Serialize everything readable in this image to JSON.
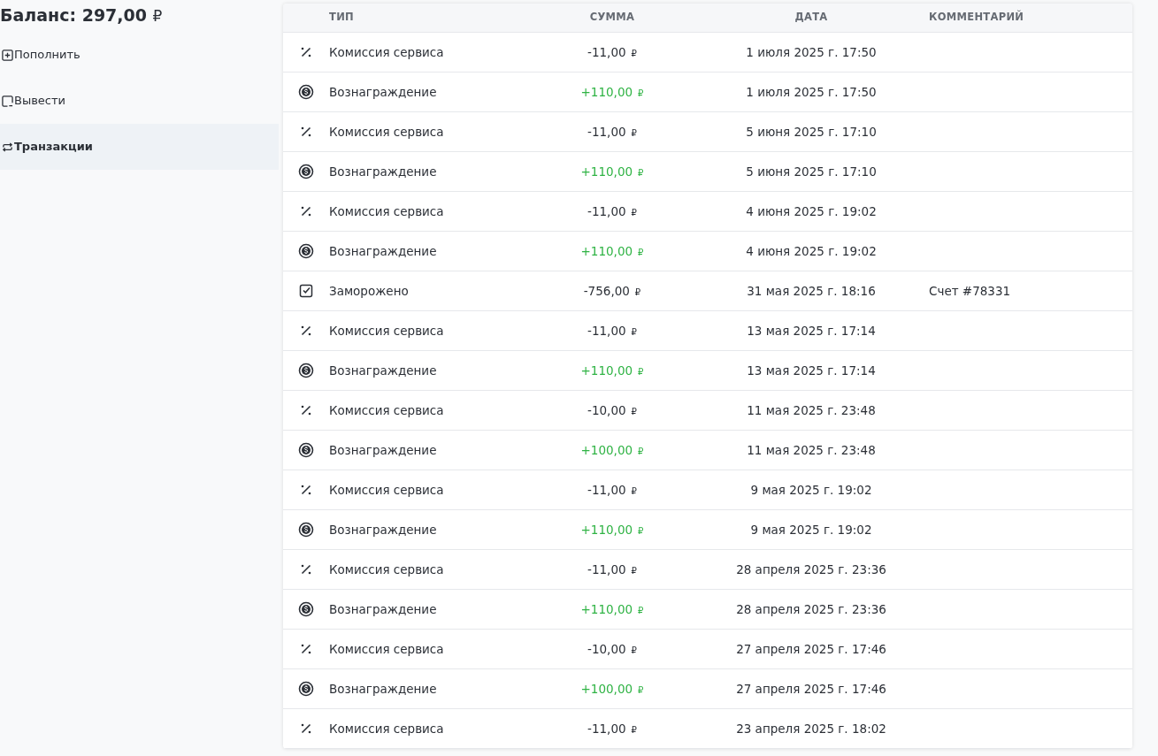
{
  "balance": {
    "label": "Баланс:",
    "amount": "297,00",
    "currency": "₽"
  },
  "menu": [
    {
      "label": "Пополнить",
      "kind": "deposit",
      "selected": false
    },
    {
      "label": "Вывести",
      "kind": "withdraw",
      "selected": false
    },
    {
      "label": "Транзакции",
      "kind": "transactions",
      "selected": true
    }
  ],
  "table": {
    "columns": [
      "ТИП",
      "СУММА",
      "ДАТА",
      "КОММЕНТАРИЙ"
    ],
    "rows": [
      {
        "kind": "commission",
        "type": "Комиссия сервиса",
        "amount": "-11,00",
        "currency": "₽",
        "positive": false,
        "date": "1 июля 2025 г. 17:50"
      },
      {
        "kind": "reward",
        "type": "Вознаграждение",
        "amount": "+110,00",
        "currency": "₽",
        "positive": true,
        "date": "1 июля 2025 г. 17:50"
      },
      {
        "kind": "commission",
        "type": "Комиссия сервиса",
        "amount": "-11,00",
        "currency": "₽",
        "positive": false,
        "date": "5 июня 2025 г. 17:10"
      },
      {
        "kind": "reward",
        "type": "Вознаграждение",
        "amount": "+110,00",
        "currency": "₽",
        "positive": true,
        "date": "5 июня 2025 г. 17:10"
      },
      {
        "kind": "commission",
        "type": "Комиссия сервиса",
        "amount": "-11,00",
        "currency": "₽",
        "positive": false,
        "date": "4 июня 2025 г. 19:02"
      },
      {
        "kind": "reward",
        "type": "Вознаграждение",
        "amount": "+110,00",
        "currency": "₽",
        "positive": true,
        "date": "4 июня 2025 г. 19:02"
      },
      {
        "kind": "frozen",
        "type": "Заморожено",
        "amount": "-756,00",
        "currency": "₽",
        "positive": false,
        "date": "31 мая 2025 г. 18:16",
        "comment": "Счет #78331"
      },
      {
        "kind": "commission",
        "type": "Комиссия сервиса",
        "amount": "-11,00",
        "currency": "₽",
        "positive": false,
        "date": "13 мая 2025 г. 17:14"
      },
      {
        "kind": "reward",
        "type": "Вознаграждение",
        "amount": "+110,00",
        "currency": "₽",
        "positive": true,
        "date": "13 мая 2025 г. 17:14"
      },
      {
        "kind": "commission",
        "type": "Комиссия сервиса",
        "amount": "-10,00",
        "currency": "₽",
        "positive": false,
        "date": "11 мая 2025 г. 23:48"
      },
      {
        "kind": "reward",
        "type": "Вознаграждение",
        "amount": "+100,00",
        "currency": "₽",
        "positive": true,
        "date": "11 мая 2025 г. 23:48"
      },
      {
        "kind": "commission",
        "type": "Комиссия сервиса",
        "amount": "-11,00",
        "currency": "₽",
        "positive": false,
        "date": "9 мая 2025 г. 19:02"
      },
      {
        "kind": "reward",
        "type": "Вознаграждение",
        "amount": "+110,00",
        "currency": "₽",
        "positive": true,
        "date": "9 мая 2025 г. 19:02"
      },
      {
        "kind": "commission",
        "type": "Комиссия сервиса",
        "amount": "-11,00",
        "currency": "₽",
        "positive": false,
        "date": "28 апреля 2025 г. 23:36"
      },
      {
        "kind": "reward",
        "type": "Вознаграждение",
        "amount": "+110,00",
        "currency": "₽",
        "positive": true,
        "date": "28 апреля 2025 г. 23:36"
      },
      {
        "kind": "commission",
        "type": "Комиссия сервиса",
        "amount": "-10,00",
        "currency": "₽",
        "positive": false,
        "date": "27 апреля 2025 г. 17:46"
      },
      {
        "kind": "reward",
        "type": "Вознаграждение",
        "amount": "+100,00",
        "currency": "₽",
        "positive": true,
        "date": "27 апреля 2025 г. 17:46"
      },
      {
        "kind": "commission",
        "type": "Комиссия сервиса",
        "amount": "-11,00",
        "currency": "₽",
        "positive": false,
        "date": "23 апреля 2025 г. 18:02"
      }
    ]
  }
}
